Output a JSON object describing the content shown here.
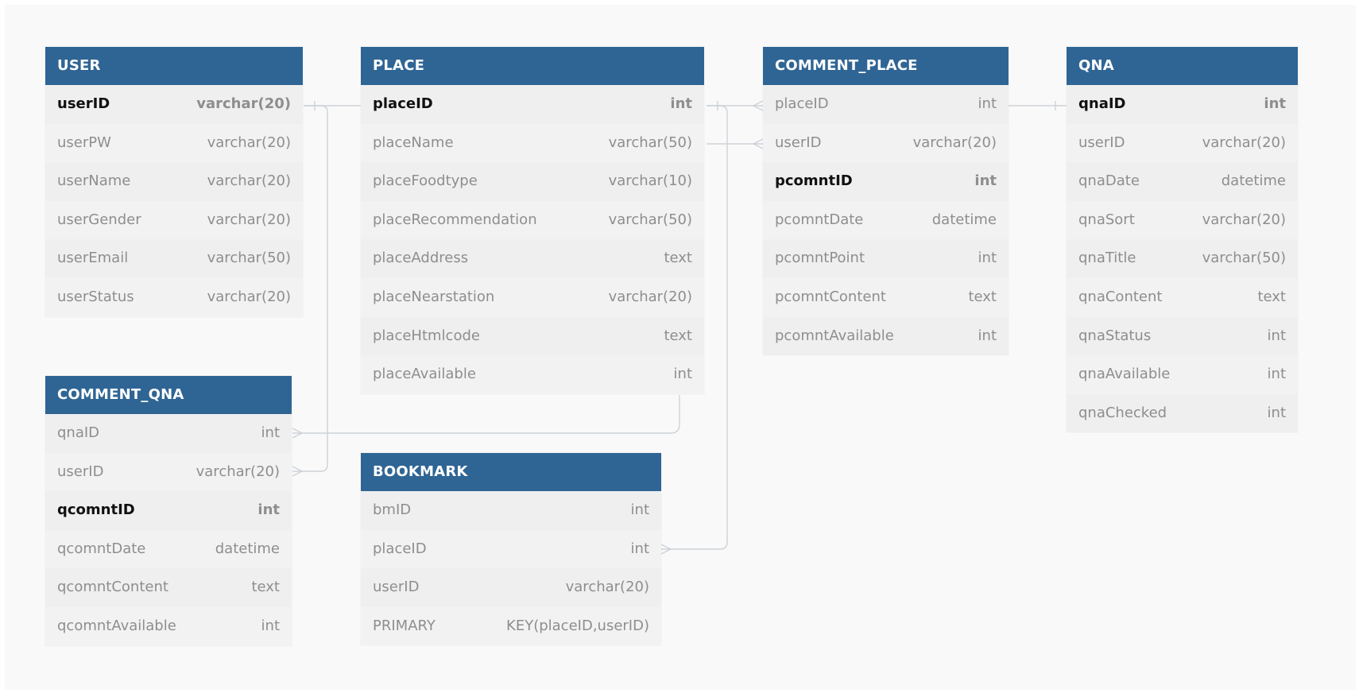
{
  "tables": {
    "user": {
      "name": "USER",
      "columns": [
        {
          "name": "userID",
          "type": "varchar(20)",
          "pk": true
        },
        {
          "name": "userPW",
          "type": "varchar(20)"
        },
        {
          "name": "userName",
          "type": "varchar(20)"
        },
        {
          "name": "userGender",
          "type": "varchar(20)"
        },
        {
          "name": "userEmail",
          "type": "varchar(50)"
        },
        {
          "name": "userStatus",
          "type": "varchar(20)"
        }
      ]
    },
    "place": {
      "name": "PLACE",
      "columns": [
        {
          "name": "placeID",
          "type": "int",
          "pk": true
        },
        {
          "name": "placeName",
          "type": "varchar(50)"
        },
        {
          "name": "placeFoodtype",
          "type": "varchar(10)"
        },
        {
          "name": "placeRecommendation",
          "type": "varchar(50)"
        },
        {
          "name": "placeAddress",
          "type": "text"
        },
        {
          "name": "placeNearstation",
          "type": "varchar(20)"
        },
        {
          "name": "placeHtmlcode",
          "type": "text"
        },
        {
          "name": "placeAvailable",
          "type": "int"
        }
      ]
    },
    "comment_place": {
      "name": "COMMENT_PLACE",
      "columns": [
        {
          "name": "placeID",
          "type": "int"
        },
        {
          "name": "userID",
          "type": "varchar(20)"
        },
        {
          "name": "pcomntID",
          "type": "int",
          "pk": true
        },
        {
          "name": "pcomntDate",
          "type": "datetime"
        },
        {
          "name": "pcomntPoint",
          "type": "int"
        },
        {
          "name": "pcomntContent",
          "type": "text"
        },
        {
          "name": "pcomntAvailable",
          "type": "int"
        }
      ]
    },
    "qna": {
      "name": "QNA",
      "columns": [
        {
          "name": "qnaID",
          "type": "int",
          "pk": true
        },
        {
          "name": "userID",
          "type": "varchar(20)"
        },
        {
          "name": "qnaDate",
          "type": "datetime"
        },
        {
          "name": "qnaSort",
          "type": "varchar(20)"
        },
        {
          "name": "qnaTitle",
          "type": "varchar(50)"
        },
        {
          "name": "qnaContent",
          "type": "text"
        },
        {
          "name": "qnaStatus",
          "type": "int"
        },
        {
          "name": "qnaAvailable",
          "type": "int"
        },
        {
          "name": "qnaChecked",
          "type": "int"
        }
      ]
    },
    "comment_qna": {
      "name": "COMMENT_QNA",
      "columns": [
        {
          "name": "qnaID",
          "type": "int"
        },
        {
          "name": "userID",
          "type": "varchar(20)"
        },
        {
          "name": "qcomntID",
          "type": "int",
          "pk": true
        },
        {
          "name": "qcomntDate",
          "type": "datetime"
        },
        {
          "name": "qcomntContent",
          "type": "text"
        },
        {
          "name": "qcomntAvailable",
          "type": "int"
        }
      ]
    },
    "bookmark": {
      "name": "BOOKMARK",
      "columns": [
        {
          "name": "bmID",
          "type": "int"
        },
        {
          "name": "placeID",
          "type": "int"
        },
        {
          "name": "userID",
          "type": "varchar(20)"
        },
        {
          "name": "PRIMARY",
          "type": "KEY(placeID,userID)"
        }
      ]
    }
  },
  "colors": {
    "header": "#2f6594",
    "canvas": "#f9f9f9",
    "connector": "#cdd2d8"
  }
}
